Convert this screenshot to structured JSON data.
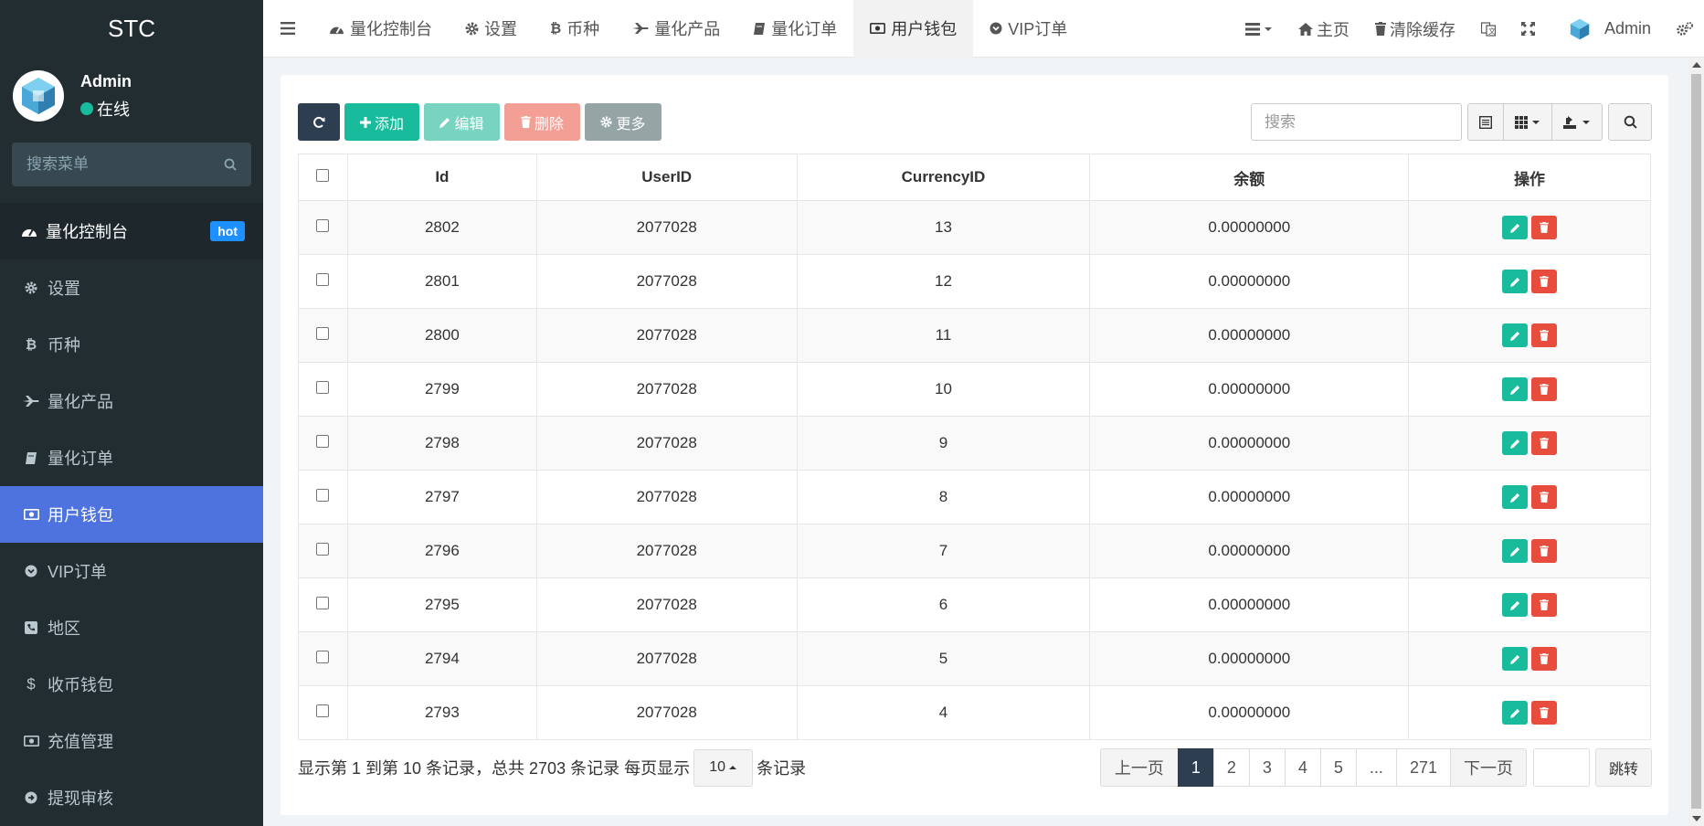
{
  "brand": "STC",
  "user": {
    "name": "Admin",
    "status": "在线"
  },
  "sidebar": {
    "search_placeholder": "搜索菜单",
    "hot_badge": "hot",
    "items": [
      {
        "label": "量化控制台",
        "icon": "dashboard-icon"
      },
      {
        "label": "设置",
        "icon": "gear-icon"
      },
      {
        "label": "币种",
        "icon": "bitcoin-icon"
      },
      {
        "label": "量化产品",
        "icon": "plane-icon"
      },
      {
        "label": "量化订单",
        "icon": "book-icon"
      },
      {
        "label": "用户钱包",
        "icon": "money-icon"
      },
      {
        "label": "VIP订单",
        "icon": "chevron-circle-icon"
      },
      {
        "label": "地区",
        "icon": "phone-square-icon"
      },
      {
        "label": "收币钱包",
        "icon": "dollar-icon"
      },
      {
        "label": "充值管理",
        "icon": "money-icon"
      },
      {
        "label": "提现审核",
        "icon": "arrow-circle-icon"
      }
    ]
  },
  "topbar": {
    "tabs": [
      {
        "label": "量化控制台",
        "icon": "dashboard-icon"
      },
      {
        "label": "设置",
        "icon": "gear-icon"
      },
      {
        "label": "币种",
        "icon": "bitcoin-icon"
      },
      {
        "label": "量化产品",
        "icon": "plane-icon"
      },
      {
        "label": "量化订单",
        "icon": "book-icon"
      },
      {
        "label": "用户钱包",
        "icon": "money-icon"
      },
      {
        "label": "VIP订单",
        "icon": "chevron-circle-icon"
      }
    ],
    "home": "主页",
    "clear_cache": "清除缓存",
    "admin": "Admin"
  },
  "toolbar": {
    "add": "添加",
    "edit": "编辑",
    "delete": "删除",
    "more": "更多"
  },
  "search": {
    "placeholder": "搜索"
  },
  "table": {
    "headers": [
      "Id",
      "UserID",
      "CurrencyID",
      "余额",
      "操作"
    ],
    "rows": [
      {
        "id": "2802",
        "userid": "2077028",
        "currencyid": "13",
        "balance": "0.00000000"
      },
      {
        "id": "2801",
        "userid": "2077028",
        "currencyid": "12",
        "balance": "0.00000000"
      },
      {
        "id": "2800",
        "userid": "2077028",
        "currencyid": "11",
        "balance": "0.00000000"
      },
      {
        "id": "2799",
        "userid": "2077028",
        "currencyid": "10",
        "balance": "0.00000000"
      },
      {
        "id": "2798",
        "userid": "2077028",
        "currencyid": "9",
        "balance": "0.00000000"
      },
      {
        "id": "2797",
        "userid": "2077028",
        "currencyid": "8",
        "balance": "0.00000000"
      },
      {
        "id": "2796",
        "userid": "2077028",
        "currencyid": "7",
        "balance": "0.00000000"
      },
      {
        "id": "2795",
        "userid": "2077028",
        "currencyid": "6",
        "balance": "0.00000000"
      },
      {
        "id": "2794",
        "userid": "2077028",
        "currencyid": "5",
        "balance": "0.00000000"
      },
      {
        "id": "2793",
        "userid": "2077028",
        "currencyid": "4",
        "balance": "0.00000000"
      }
    ]
  },
  "footer": {
    "info_before": "显示第 1 到第 10 条记录，总共 2703 条记录 每页显示",
    "page_size": "10",
    "info_after": "条记录"
  },
  "pagination": {
    "prev": "上一页",
    "pages": [
      "1",
      "2",
      "3",
      "4",
      "5",
      "...",
      "271"
    ],
    "next": "下一页",
    "jump": "跳转"
  },
  "colors": {
    "sidebar_bg": "#222d32",
    "active_menu": "#4e73df",
    "primary_dark": "#2c3e50",
    "success": "#18bc9c",
    "danger": "#e74c3c",
    "hot_badge": "#1e90ff"
  }
}
